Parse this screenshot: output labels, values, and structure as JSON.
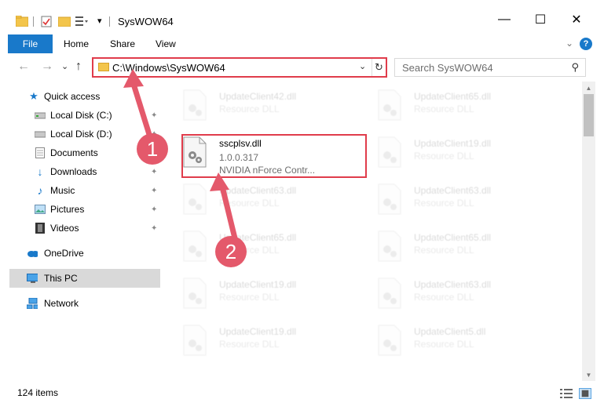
{
  "window": {
    "title": "SysWOW64",
    "minimize": "—",
    "maximize": "☐",
    "close": "✕"
  },
  "ribbon": {
    "file": "File",
    "home": "Home",
    "share": "Share",
    "view": "View",
    "expand": "⌄",
    "help": "?"
  },
  "nav": {
    "back": "←",
    "forward": "→",
    "recent": "⌄",
    "up": "↑",
    "address": "C:\\Windows\\SysWOW64",
    "address_dropdown": "⌄",
    "refresh": "↻",
    "search_placeholder": "Search SysWOW64",
    "search_icon": "⚲"
  },
  "sidebar": {
    "items": [
      {
        "label": "Quick access",
        "icon": "star-icon",
        "pinned": false
      },
      {
        "label": "Local Disk (C:)",
        "icon": "drive-icon",
        "pinned": true
      },
      {
        "label": "Local Disk (D:)",
        "icon": "drive-icon",
        "pinned": true
      },
      {
        "label": "Documents",
        "icon": "documents-icon",
        "pinned": true
      },
      {
        "label": "Downloads",
        "icon": "download-icon",
        "pinned": true
      },
      {
        "label": "Music",
        "icon": "music-icon",
        "pinned": true
      },
      {
        "label": "Pictures",
        "icon": "pictures-icon",
        "pinned": true
      },
      {
        "label": "Videos",
        "icon": "video-icon",
        "pinned": true
      },
      {
        "label": "OneDrive",
        "icon": "cloud-icon",
        "pinned": false
      },
      {
        "label": "This PC",
        "icon": "pc-icon",
        "pinned": false,
        "selected": true
      },
      {
        "label": "Network",
        "icon": "network-icon",
        "pinned": false
      }
    ],
    "pin_glyph": "📌"
  },
  "files": {
    "left": [
      {
        "name": "UpdateClient42.dll",
        "type": "Resource DLL"
      },
      {
        "name": "sscplsv.dll",
        "version": "1.0.0.317",
        "company": "NVIDIA nForce Contr...",
        "highlighted": true
      },
      {
        "name": "UpdateClient63.dll",
        "type": "Resource DLL"
      },
      {
        "name": "UpdateClient65.dll",
        "type": "Resource DLL"
      },
      {
        "name": "UpdateClient19.dll",
        "type": "Resource DLL"
      },
      {
        "name": "UpdateClient19.dll",
        "type": "Resource DLL"
      }
    ],
    "right": [
      {
        "name": "UpdateClient65.dll",
        "type": "Resource DLL"
      },
      {
        "name": "UpdateClient19.dll",
        "type": "Resource DLL"
      },
      {
        "name": "UpdateClient63.dll",
        "type": "Resource DLL"
      },
      {
        "name": "UpdateClient65.dll",
        "type": "Resource DLL"
      },
      {
        "name": "UpdateClient63.dll",
        "type": "Resource DLL"
      },
      {
        "name": "UpdateClient5.dll",
        "type": "Resource DLL"
      }
    ]
  },
  "status": {
    "item_count": "124 items"
  },
  "annotations": {
    "step1": "1",
    "step2": "2",
    "color": "#e4596b"
  },
  "colors": {
    "accent": "#1979ca",
    "highlight": "#e03c4b",
    "selected": "#d9d9d9"
  }
}
